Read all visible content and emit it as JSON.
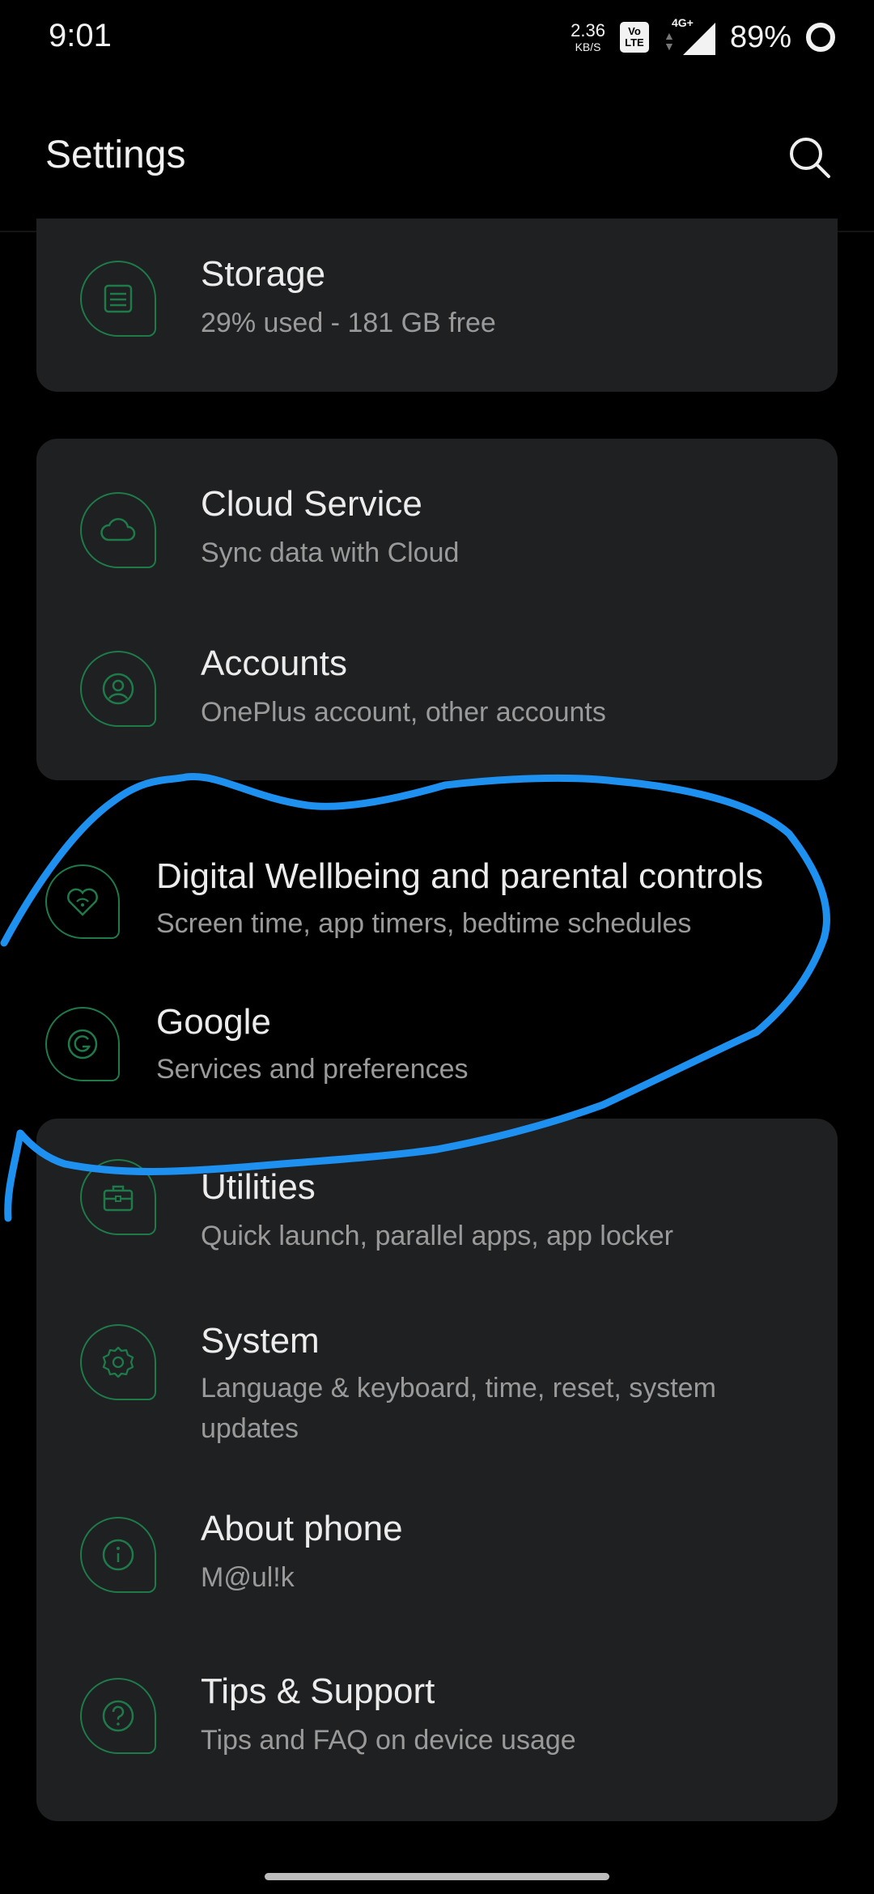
{
  "status_bar": {
    "time": "9:01",
    "net_speed_value": "2.36",
    "net_speed_unit": "KB/S",
    "volte_top": "Vo",
    "volte_bottom": "LTE",
    "network_type": "4G+",
    "battery_percent": "89%",
    "battery_level": 0.89
  },
  "header": {
    "title": "Settings",
    "search_icon": "search-icon"
  },
  "colors": {
    "background": "#000000",
    "card": "#1f2022",
    "icon_accent": "#1f7a4a",
    "annotation": "#1e90f0"
  },
  "settings": {
    "storage": {
      "title": "Storage",
      "subtitle": "29% used - 181 GB free",
      "icon": "storage-icon"
    },
    "cloud_service": {
      "title": "Cloud Service",
      "subtitle": "Sync data with Cloud",
      "icon": "cloud-icon"
    },
    "accounts": {
      "title": "Accounts",
      "subtitle": "OnePlus account, other accounts",
      "icon": "account-icon"
    },
    "digital_wellbeing": {
      "title": "Digital Wellbeing and parental controls",
      "subtitle": "Screen time, app timers, bedtime schedules",
      "icon": "heart-icon"
    },
    "google": {
      "title": "Google",
      "subtitle": "Services and preferences",
      "icon": "google-icon"
    },
    "utilities": {
      "title": "Utilities",
      "subtitle": "Quick launch, parallel apps, app locker",
      "icon": "toolbox-icon"
    },
    "system": {
      "title": "System",
      "subtitle": "Language & keyboard, time, reset, system updates",
      "icon": "gear-icon"
    },
    "about_phone": {
      "title": "About phone",
      "subtitle": "M@ul!k",
      "icon": "info-icon"
    },
    "tips_support": {
      "title": "Tips & Support",
      "subtitle": "Tips and FAQ on device usage",
      "icon": "help-icon"
    }
  }
}
